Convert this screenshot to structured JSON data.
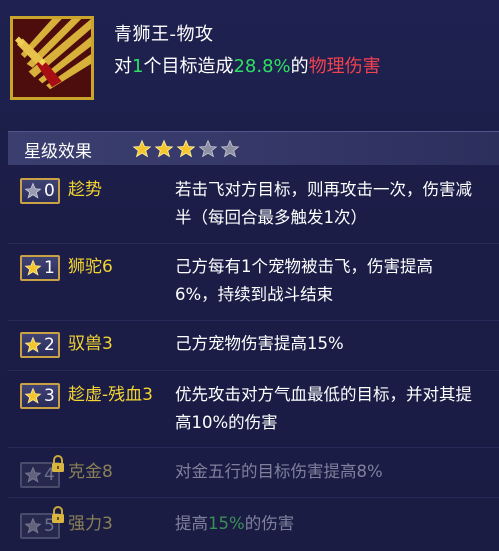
{
  "skill": {
    "name": "青狮王-物攻",
    "desc_prefix": "对",
    "target_count": "1",
    "desc_mid": "个目标造成",
    "percent": "28.8%",
    "desc_of": "的",
    "damage_type": "物理伤害",
    "icon": "sword-icon"
  },
  "faded_top_text": "",
  "star_section": {
    "title": "星级效果",
    "stars_filled": 3,
    "stars_total": 5
  },
  "perks": [
    {
      "level": "0",
      "name": "趁势",
      "desc": "若击飞对方目标，则再攻击一次，伤害减半（每回合最多触发1次）",
      "locked": false,
      "star": "gray"
    },
    {
      "level": "1",
      "name": "狮驼6",
      "desc": "己方每有1个宠物被击飞，伤害提高6%，持续到战斗结束",
      "locked": false,
      "star": "gold"
    },
    {
      "level": "2",
      "name": "驭兽3",
      "desc": "己方宠物伤害提高15%",
      "locked": false,
      "star": "gold"
    },
    {
      "level": "3",
      "name": "趁虚-残血3",
      "desc": "优先攻击对方气血最低的目标，并对其提高10%的伤害",
      "locked": false,
      "star": "gold"
    },
    {
      "level": "4",
      "name": "克金8",
      "desc": "对金五行的目标伤害提高8%",
      "locked": true,
      "star": "gray"
    },
    {
      "level": "5",
      "name": "强力3",
      "desc_prefix": "提高",
      "desc_value": "15%",
      "desc_suffix": "的伤害",
      "locked": true,
      "star": "gray"
    }
  ],
  "colors": {
    "accent_green": "#2ee063",
    "accent_red": "#f0424f",
    "perk_name_gold": "#f3d431",
    "background": "#1b1d45"
  }
}
